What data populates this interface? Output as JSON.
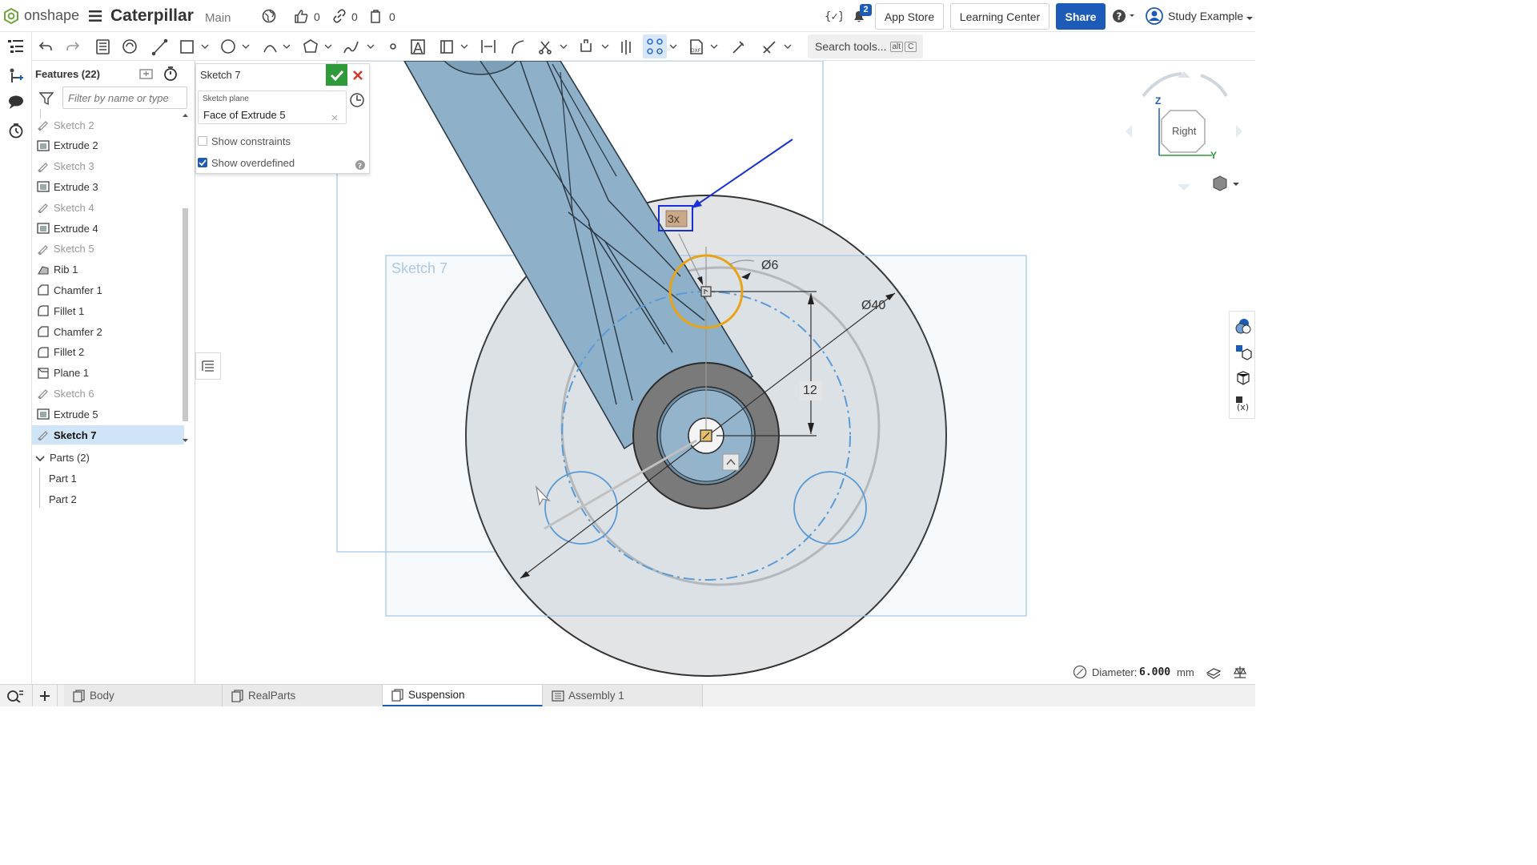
{
  "app": {
    "brand": "onshape",
    "document_title": "Caterpillar",
    "branch": "Main",
    "likes": "0",
    "links": "0",
    "copies": "0",
    "notifications_badge": "2",
    "app_store": "App Store",
    "learning_center": "Learning Center",
    "share": "Share",
    "user": "Study Example"
  },
  "toolbar": {
    "search_label": "Search tools...",
    "shortcut_alt": "alt",
    "shortcut_key": "C"
  },
  "features_panel": {
    "title": "Features (22)",
    "filter_placeholder": "Filter by name or type",
    "items": [
      {
        "label": "Sketch 2",
        "kind": "sketch",
        "dim": true
      },
      {
        "label": "Extrude 2",
        "kind": "extrude",
        "dim": false
      },
      {
        "label": "Sketch 3",
        "kind": "sketch",
        "dim": true
      },
      {
        "label": "Extrude 3",
        "kind": "extrude",
        "dim": false
      },
      {
        "label": "Sketch 4",
        "kind": "sketch",
        "dim": true
      },
      {
        "label": "Extrude 4",
        "kind": "extrude",
        "dim": false
      },
      {
        "label": "Sketch 5",
        "kind": "sketch",
        "dim": true
      },
      {
        "label": "Rib 1",
        "kind": "rib",
        "dim": false
      },
      {
        "label": "Chamfer 1",
        "kind": "chamfer",
        "dim": false
      },
      {
        "label": "Fillet 1",
        "kind": "fillet",
        "dim": false
      },
      {
        "label": "Chamfer 2",
        "kind": "chamfer",
        "dim": false
      },
      {
        "label": "Fillet 2",
        "kind": "fillet",
        "dim": false
      },
      {
        "label": "Plane 1",
        "kind": "plane",
        "dim": false
      },
      {
        "label": "Sketch 6",
        "kind": "sketch",
        "dim": true
      },
      {
        "label": "Extrude 5",
        "kind": "extrude",
        "dim": false
      },
      {
        "label": "Sketch 7",
        "kind": "sketch",
        "dim": false,
        "selected": true
      }
    ],
    "parts_header": "Parts (2)",
    "parts": [
      "Part 1",
      "Part 2"
    ]
  },
  "sketch_dialog": {
    "title": "Sketch 7",
    "plane_label": "Sketch plane",
    "plane_value": "Face of Extrude 5",
    "show_constraints": "Show constraints",
    "show_constraints_checked": false,
    "show_overdefined": "Show overdefined",
    "show_overdefined_checked": true
  },
  "viewport": {
    "sketch_label": "Sketch 7",
    "pattern_count": "3x",
    "dim_small_diameter": "Ø6",
    "dim_large_diameter": "Ø40",
    "dim_offset": "12",
    "view_cube_face": "Right",
    "axis_z": "Z",
    "axis_y": "Y",
    "status_label": "Diameter:",
    "status_value": "6.000",
    "status_unit": "mm",
    "highlight_color": "#e8a317",
    "selection_color": "#1a2fd6",
    "sketch_color": "#5a9bd5"
  },
  "tabs": [
    {
      "label": "Body",
      "active": false
    },
    {
      "label": "RealParts",
      "active": false
    },
    {
      "label": "Suspension",
      "active": true
    },
    {
      "label": "Assembly 1",
      "active": false
    }
  ]
}
